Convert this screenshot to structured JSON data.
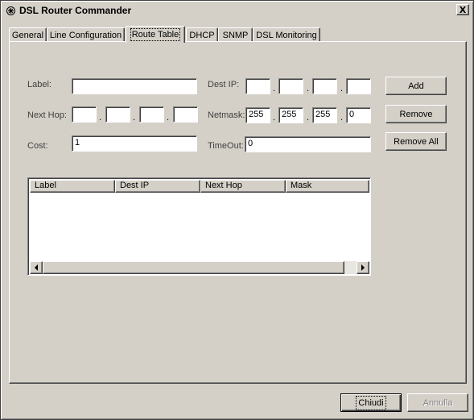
{
  "window": {
    "title": "DSL Router Commander",
    "close_glyph": "X"
  },
  "tabs": [
    {
      "label": "General"
    },
    {
      "label": "Line Configuration"
    },
    {
      "label": "Route Table"
    },
    {
      "label": "DHCP"
    },
    {
      "label": "SNMP"
    },
    {
      "label": "DSL Monitoring"
    }
  ],
  "route_form": {
    "label": {
      "text": "Label:",
      "value": ""
    },
    "next_hop": {
      "text": "Next Hop:",
      "octets": [
        "",
        "",
        "",
        ""
      ]
    },
    "cost": {
      "text": "Cost:",
      "value": "1"
    },
    "dest_ip": {
      "text": "Dest IP:",
      "octets": [
        "",
        "",
        "",
        ""
      ]
    },
    "netmask": {
      "text": "Netmask:",
      "octets": [
        "255",
        "255",
        "255",
        "0"
      ]
    },
    "timeout": {
      "text": "TimeOut:",
      "value": "0"
    },
    "separator": "."
  },
  "buttons": {
    "add": "Add",
    "remove": "Remove",
    "remove_all": "Remove All"
  },
  "route_list": {
    "columns": [
      "Label",
      "Dest IP",
      "Next Hop",
      "Mask"
    ],
    "rows": []
  },
  "footer": {
    "chiudi": "Chiudi",
    "annulla": "Annulla"
  },
  "colors": {
    "face": "#d4d0c8",
    "highlight": "#ffffff",
    "shadow": "#808080",
    "dark_shadow": "#404040"
  },
  "icons": {
    "app": "router-icon",
    "close": "close-icon",
    "scroll_left": "scroll-left-arrow-icon",
    "scroll_right": "scroll-right-arrow-icon"
  }
}
